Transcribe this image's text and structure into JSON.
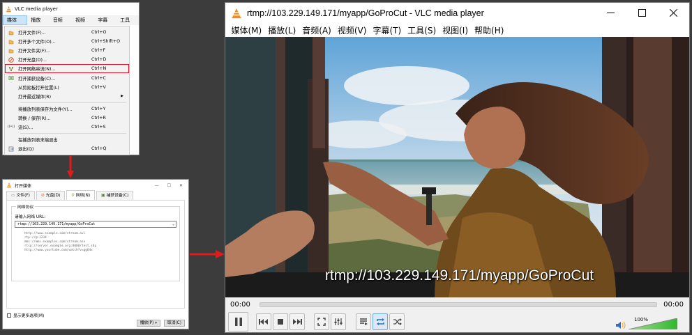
{
  "mini_window": {
    "title": "VLC media player",
    "menubar": [
      "媒体(M)",
      "播放(L)",
      "音频(A)",
      "视频(V)",
      "字幕(T)",
      "工具(S)"
    ],
    "menu_items": [
      {
        "icon": "open-file-icon",
        "label": "打开文件(F)...",
        "shortcut": "Ctrl+O"
      },
      {
        "icon": "open-multiple-icon",
        "label": "打开多个文件(O)...",
        "shortcut": "Ctrl+Shift+O"
      },
      {
        "icon": "open-folder-icon",
        "label": "打开文件夹(F)...",
        "shortcut": "Ctrl+F"
      },
      {
        "icon": "open-disc-icon",
        "label": "打开光盘(D)...",
        "shortcut": "Ctrl+D"
      },
      {
        "icon": "network-icon",
        "label": "打开网络串流(N)...",
        "shortcut": "Ctrl+N",
        "highlight": true
      },
      {
        "icon": "capture-icon",
        "label": "打开捕获设备(C)...",
        "shortcut": "Ctrl+C"
      },
      {
        "icon": "",
        "label": "从剪贴板打开位置(L)",
        "shortcut": "Ctrl+V"
      },
      {
        "icon": "",
        "label": "打开最近媒体(R)",
        "shortcut": "",
        "submenu": true
      },
      {
        "separator": true
      },
      {
        "icon": "",
        "label": "将播放列表保存为文件(Y)...",
        "shortcut": "Ctrl+Y"
      },
      {
        "icon": "",
        "label": "转换 / 保存(R)...",
        "shortcut": "Ctrl+R"
      },
      {
        "icon": "stream-icon",
        "label": "流(S)...",
        "shortcut": "Ctrl+S"
      },
      {
        "separator": true
      },
      {
        "icon": "",
        "label": "在播放列表末端退出",
        "shortcut": ""
      },
      {
        "icon": "quit-icon",
        "label": "退出(Q)",
        "shortcut": "Ctrl+Q"
      }
    ]
  },
  "dialog": {
    "title": "打开媒体",
    "tabs": [
      {
        "label": "文件(F)",
        "icon": "file-icon"
      },
      {
        "label": "光盘(D)",
        "icon": "disc-icon"
      },
      {
        "label": "网络(N)",
        "icon": "network-icon",
        "active": true
      },
      {
        "label": "捕获设备(C)",
        "icon": "capture-icon"
      }
    ],
    "group_title": "网络协议",
    "url_label": "请输入网络 URL:",
    "url_value": "rtmp://103.229.149.171/myapp/GoProCut",
    "examples": [
      "http://www.example.com/stream.avi",
      "rtp://@:1234",
      "mms://mms.examples.com/stream.asx",
      "rtsp://server.example.org:8080/test.sdp",
      "http://www.yourtube.com/watch?v=gg64x"
    ],
    "more_options_label": "显示更多选项(M)",
    "play_button": "播放(P)",
    "cancel_button": "取消(C)"
  },
  "main_window": {
    "title": "rtmp://103.229.149.171/myapp/GoProCut - VLC media player",
    "menubar": [
      "媒体(M)",
      "播放(L)",
      "音频(A)",
      "视频(V)",
      "字幕(T)",
      "工具(S)",
      "视图(I)",
      "帮助(H)"
    ],
    "subtitle": "rtmp://103.229.149.171/myapp/GoProCut",
    "time_elapsed": "00:00",
    "time_total": "00:00",
    "volume": "100%",
    "volume_level": 1.0
  },
  "colors": {
    "highlight_box": "#e81123",
    "arrow": "#e21a1a",
    "accent": "#3a8fd8"
  }
}
